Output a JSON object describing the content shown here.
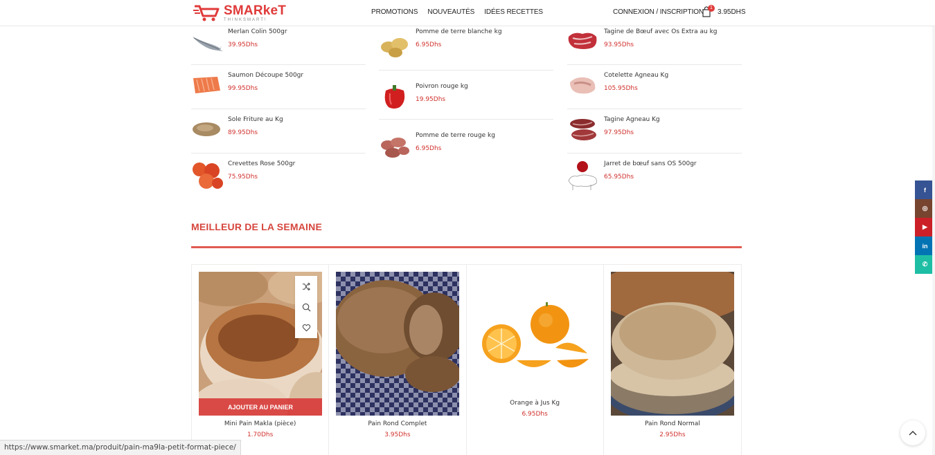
{
  "header": {
    "logo_word": "SMARkeT",
    "logo_tagline": "THINKSMART!",
    "nav": [
      "PROMOTIONS",
      "NOUVEAUTÉS",
      "IDÉES RECETTES"
    ],
    "account_label": "CONNEXION / INSCRIPTION",
    "cart_count": "1",
    "cart_total": "3.95DHS"
  },
  "columns": [
    {
      "items": [
        {
          "name": "Merlan Colin 500gr",
          "price": "39.95Dhs",
          "icon": "fish-icon"
        },
        {
          "name": "Saumon Découpe 500gr",
          "price": "99.95Dhs",
          "icon": "salmon-icon"
        },
        {
          "name": "Sole Friture au Kg",
          "price": "89.95Dhs",
          "icon": "sole-icon"
        },
        {
          "name": "Crevettes Rose 500gr",
          "price": "75.95Dhs",
          "icon": "shrimp-icon"
        }
      ]
    },
    {
      "items": [
        {
          "name": "Pomme de terre blanche kg",
          "price": "6.95Dhs",
          "icon": "potato-icon"
        },
        {
          "name": "Poivron rouge kg",
          "price": "19.95Dhs",
          "icon": "pepper-icon"
        },
        {
          "name": "Pomme de terre rouge kg",
          "price": "6.95Dhs",
          "icon": "red-potato-icon"
        }
      ]
    },
    {
      "items": [
        {
          "name": "Tagine de Bœuf avec Os Extra au kg",
          "price": "93.95Dhs",
          "icon": "beef-icon"
        },
        {
          "name": "Cotelette Agneau Kg",
          "price": "105.95Dhs",
          "icon": "lamb-chop-icon"
        },
        {
          "name": "Tagine Agneau Kg",
          "price": "97.95Dhs",
          "icon": "lamb-icon"
        },
        {
          "name": "Jarret de bœuf sans OS 500gr",
          "price": "65.95Dhs",
          "icon": "beef-shank-icon"
        }
      ]
    }
  ],
  "section": {
    "title": "MEILLEUR DE LA SEMAINE"
  },
  "products": [
    {
      "name": "Mini Pain Makla (pièce)",
      "price": "1.70Dhs",
      "add_label": "AJOUTER AU PANIER"
    },
    {
      "name": "Pain Rond Complet",
      "price": "3.95Dhs"
    },
    {
      "name": "Orange à Jus Kg",
      "price": "6.95Dhs"
    },
    {
      "name": "Pain Rond Normal",
      "price": "2.95Dhs"
    }
  ],
  "social": [
    {
      "icon": "facebook-icon",
      "glyph": "f",
      "color": "#365493"
    },
    {
      "icon": "instagram-icon",
      "glyph": "◎",
      "color": "#774430"
    },
    {
      "icon": "youtube-icon",
      "glyph": "▶",
      "color": "#cb2027"
    },
    {
      "icon": "linkedin-icon",
      "glyph": "in",
      "color": "#0274b3"
    },
    {
      "icon": "whatsapp-icon",
      "glyph": "✆",
      "color": "#1ebea5"
    }
  ],
  "status_url": "https://www.smarket.ma/produit/pain-ma9la-petit-format-piece/",
  "colors": {
    "brand": "#e03a3a",
    "price": "#d0312d"
  }
}
